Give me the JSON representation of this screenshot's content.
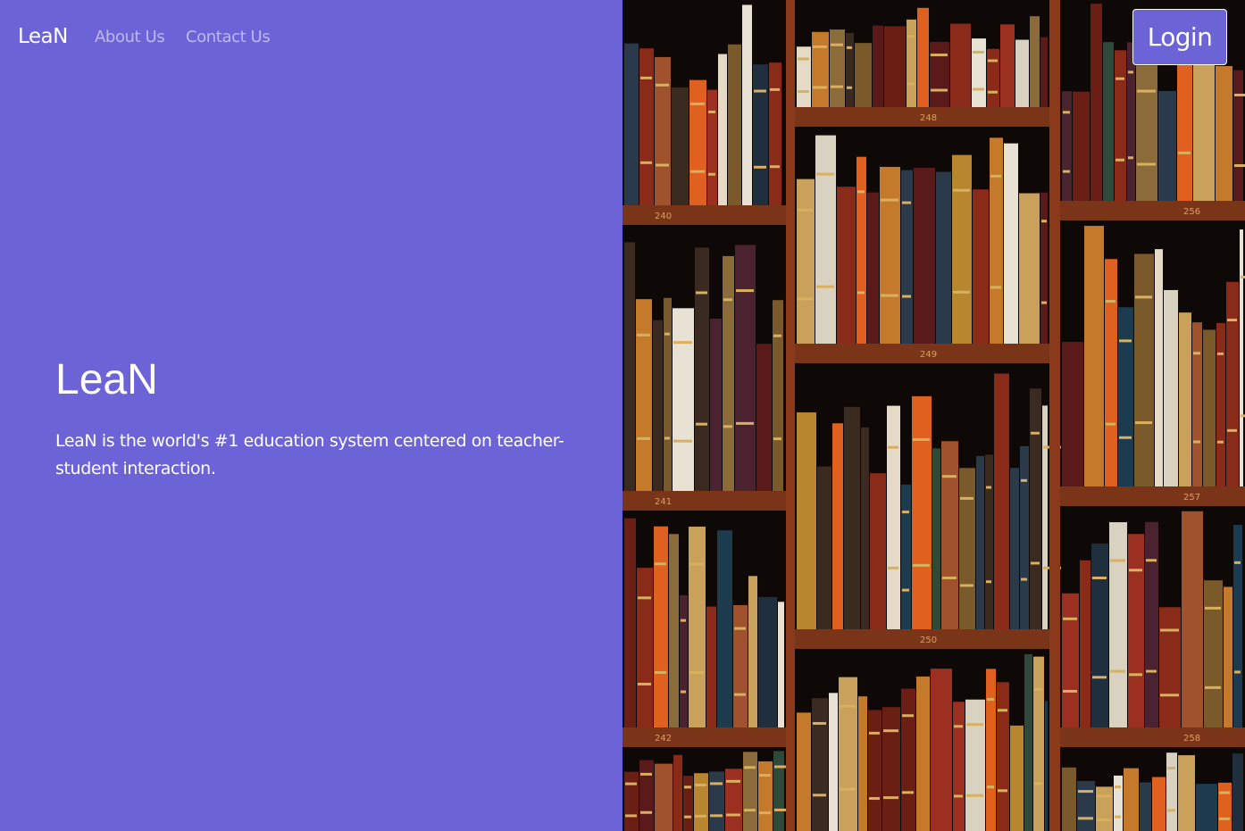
{
  "navbar": {
    "brand": "LeaN",
    "links": [
      {
        "label": "About Us"
      },
      {
        "label": "Contact Us"
      }
    ],
    "login_label": "Login"
  },
  "hero": {
    "title": "LeaN",
    "description": "LeaN is the world's #1 education system centered on teacher-student interaction."
  },
  "image": {
    "subject": "bookshelves",
    "shelf_numbers": [
      "240",
      "241",
      "242",
      "248",
      "249",
      "250",
      "256",
      "257",
      "258"
    ]
  },
  "colors": {
    "accent": "#6c63d6",
    "text": "#ffffff",
    "nav_link": "rgba(255,255,255,0.55)",
    "shelf_wood": "#7a3518"
  }
}
